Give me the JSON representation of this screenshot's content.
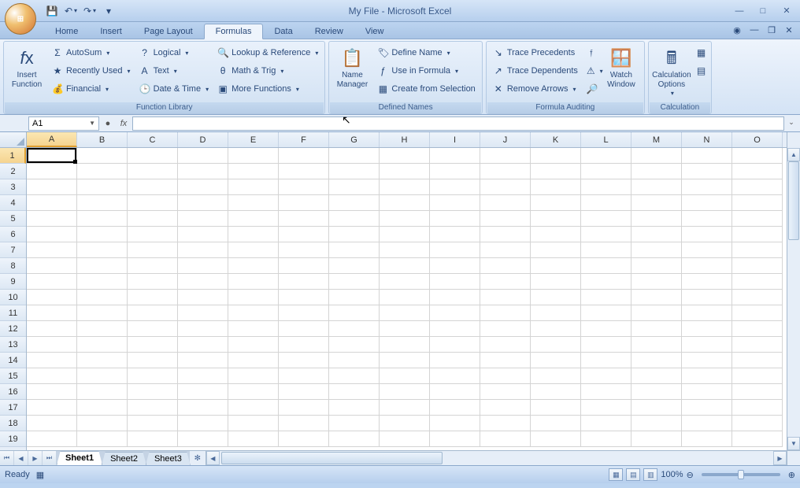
{
  "title": "My File - Microsoft Excel",
  "qat": {
    "save": "💾",
    "undo": "↶",
    "redo": "↷"
  },
  "tabs": [
    "Home",
    "Insert",
    "Page Layout",
    "Formulas",
    "Data",
    "Review",
    "View"
  ],
  "active_tab": "Formulas",
  "ribbon": {
    "function_library": {
      "label": "Function Library",
      "insert_function": "Insert\nFunction",
      "autosum": "AutoSum",
      "recently_used": "Recently Used",
      "financial": "Financial",
      "logical": "Logical",
      "text": "Text",
      "date_time": "Date & Time",
      "lookup_reference": "Lookup & Reference",
      "math_trig": "Math & Trig",
      "more_functions": "More Functions"
    },
    "defined_names": {
      "label": "Defined Names",
      "name_manager": "Name\nManager",
      "define_name": "Define Name",
      "use_in_formula": "Use in Formula",
      "create_from_selection": "Create from Selection"
    },
    "formula_auditing": {
      "label": "Formula Auditing",
      "trace_precedents": "Trace Precedents",
      "trace_dependents": "Trace Dependents",
      "remove_arrows": "Remove Arrows",
      "watch_window": "Watch\nWindow"
    },
    "calculation": {
      "label": "Calculation",
      "calculation_options": "Calculation\nOptions"
    }
  },
  "name_box": "A1",
  "columns": [
    "A",
    "B",
    "C",
    "D",
    "E",
    "F",
    "G",
    "H",
    "I",
    "J",
    "K",
    "L",
    "M",
    "N",
    "O"
  ],
  "rows": [
    1,
    2,
    3,
    4,
    5,
    6,
    7,
    8,
    9,
    10,
    11,
    12,
    13,
    14,
    15,
    16,
    17,
    18,
    19
  ],
  "active_cell": "A1",
  "sheets": [
    "Sheet1",
    "Sheet2",
    "Sheet3"
  ],
  "active_sheet": "Sheet1",
  "status": "Ready",
  "zoom": "100%"
}
